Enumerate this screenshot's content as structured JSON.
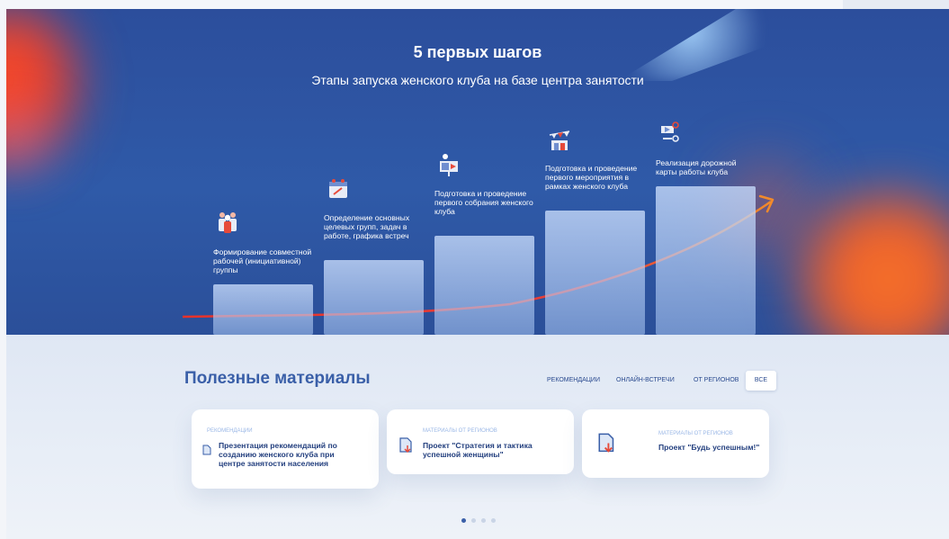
{
  "hero": {
    "title": "5 первых шагов",
    "subtitle": "Этапы запуска женского клуба на базе центра занятости",
    "steps": [
      {
        "icon": "team-icon",
        "label": "Формирование совместной рабочей (инициативной) группы"
      },
      {
        "icon": "calendar-icon",
        "label": "Определение основных целевых групп, задач в работе, графика встреч"
      },
      {
        "icon": "presentation-icon",
        "label": "Подготовка и проведение первого собрания женского клуба"
      },
      {
        "icon": "event-icon",
        "label": "Подготовка и проведение первого мероприятия в рамках женского клуба"
      },
      {
        "icon": "roadmap-icon",
        "label": "Реализация дорожной карты работы клуба"
      }
    ]
  },
  "materials": {
    "title": "Полезные материалы",
    "filters": [
      "РЕКОМЕНДАЦИИ",
      "ОНЛАЙН-ВСТРЕЧИ",
      "ОТ РЕГИОНОВ",
      "ВСЕ"
    ],
    "active_filter": "ВСЕ",
    "cards": [
      {
        "category": "РЕКОМЕНДАЦИИ",
        "title": "Презентация рекомендаций по созданию женского клуба при центре занятости населения",
        "icon": "document-icon"
      },
      {
        "category": "МАТЕРИАЛЫ ОТ РЕГИОНОВ",
        "title": "Проект \"Стратегия и тактика успешной женщины\"",
        "icon": "document-download-icon"
      },
      {
        "category": "МАТЕРИАЛЫ ОТ РЕГИОНОВ",
        "title": "Проект \"Будь успешным!\"",
        "icon": "document-download-icon"
      }
    ],
    "pager": {
      "pages": 4,
      "current": 1
    }
  },
  "colors": {
    "hero_bg": "#2f5aa8",
    "accent_red": "#e8322a",
    "accent_orange": "#f27a2a",
    "title_blue": "#3a5fa8",
    "card_title": "#24407f",
    "category_blue": "#9ab7e6"
  }
}
